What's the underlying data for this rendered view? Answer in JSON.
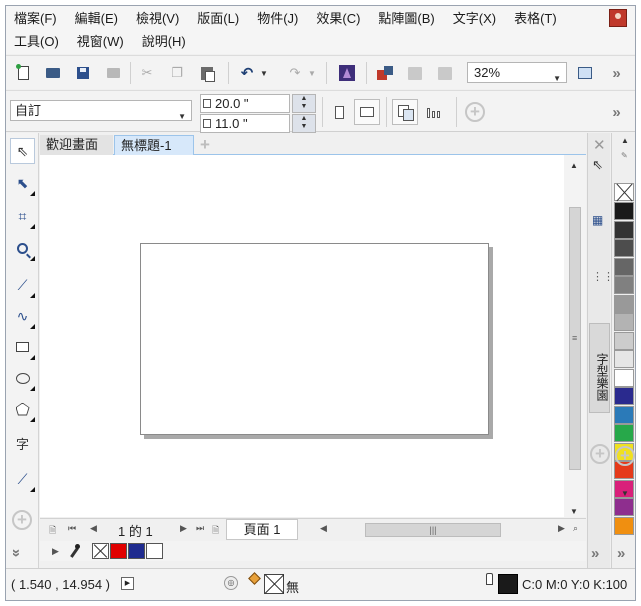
{
  "menus_row1": [
    "檔案(F)",
    "編輯(E)",
    "檢視(V)",
    "版面(L)",
    "物件(J)",
    "效果(C)",
    "點陣圖(B)",
    "文字(X)",
    "表格(T)"
  ],
  "menus_row2": [
    "工具(O)",
    "視窗(W)",
    "說明(H)"
  ],
  "toolbar": {
    "zoom_value": "32%"
  },
  "property_bar": {
    "preset": "自訂",
    "width": "20.0 \"",
    "height": "11.0 \""
  },
  "tabs": {
    "welcome": "歡迎畫面",
    "untitled": "無標題-1"
  },
  "page_nav": {
    "count": "1 的 1",
    "page_tab": "頁面 1"
  },
  "dock": {
    "label": "字型樂園"
  },
  "palette": {
    "colors": [
      "#1a1a1a",
      "#333333",
      "#4d4d4d",
      "#666666",
      "#808080",
      "#999999",
      "#b3b3b3",
      "#cccccc",
      "#e6e6e6",
      "#ffffff",
      "#2a2a8e",
      "#2b7ab8",
      "#27a84a",
      "#f0e020",
      "#e53a1b",
      "#d9207a",
      "#8e2e8e",
      "#f08f10"
    ]
  },
  "document_colors": [
    "#e00000",
    "#1f2b8f",
    "#ffffff"
  ],
  "status": {
    "coords": "( 1.540 , 14.954 )",
    "fill_label": "無",
    "outline_label": "C:0 M:0 Y:0 K:100"
  }
}
